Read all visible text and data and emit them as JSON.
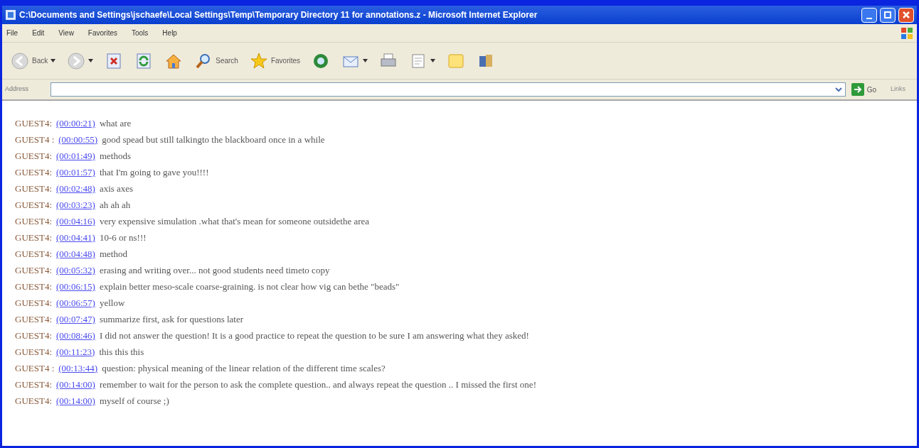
{
  "window": {
    "title": "C:\\Documents and Settings\\jschaefe\\Local Settings\\Temp\\Temporary Directory 11 for annotations.z - Microsoft Internet Explorer"
  },
  "menu": [
    "File",
    "Edit",
    "View",
    "Favorites",
    "Tools",
    "Help"
  ],
  "toolbar": [
    {
      "kind": "back",
      "label": "Back"
    },
    {
      "kind": "forward"
    },
    {
      "kind": "stop"
    },
    {
      "kind": "refresh"
    },
    {
      "kind": "home"
    },
    {
      "kind": "search",
      "label": "Search"
    },
    {
      "kind": "favorites",
      "label": "Favorites"
    },
    {
      "kind": "media"
    },
    {
      "kind": "mail"
    },
    {
      "kind": "print"
    },
    {
      "kind": "edit"
    },
    {
      "kind": "notes"
    },
    {
      "kind": "messenger"
    }
  ],
  "address_bar": {
    "label": "Address",
    "go": "Go",
    "links": "Links"
  },
  "entries": [
    {
      "speaker": "GUEST4:",
      "time": "(00:00:21)",
      "message": "what are"
    },
    {
      "speaker": "GUEST4 :",
      "time": "(00:00:55)",
      "message": "good spead but still talkingto the blackboard once in a while"
    },
    {
      "speaker": "GUEST4:",
      "time": "(00:01:49)",
      "message": "methods"
    },
    {
      "speaker": "GUEST4:",
      "time": "(00:01:57)",
      "message": "that I'm going to gave you!!!!"
    },
    {
      "speaker": "GUEST4:",
      "time": "(00:02:48)",
      "message": "axis axes"
    },
    {
      "speaker": "GUEST4:",
      "time": "(00:03:23)",
      "message": "ah ah ah"
    },
    {
      "speaker": "GUEST4:",
      "time": "(00:04:16)",
      "message": "very expensive simulation .what that's mean for someone outsidethe area"
    },
    {
      "speaker": "GUEST4:",
      "time": "(00:04:41)",
      "message": "10-6 or ns!!!"
    },
    {
      "speaker": "GUEST4:",
      "time": "(00:04:48)",
      "message": "method"
    },
    {
      "speaker": "GUEST4:",
      "time": "(00:05:32)",
      "message": "erasing and writing over... not good students need timeto copy"
    },
    {
      "speaker": "GUEST4:",
      "time": "(00:06:15)",
      "message": "explain better meso-scale coarse-graining. is not clear how vig can bethe \"beads\""
    },
    {
      "speaker": "GUEST4:",
      "time": "(00:06:57)",
      "message": "yellow"
    },
    {
      "speaker": "GUEST4:",
      "time": "(00:07:47)",
      "message": "summarize first, ask for questions later"
    },
    {
      "speaker": "GUEST4:",
      "time": "(00:08:46)",
      "message": "I did not answer the question! It is a good practice to repeat the question to be sure I am answering what they asked!"
    },
    {
      "speaker": "GUEST4:",
      "time": "(00:11:23)",
      "message": "this this this"
    },
    {
      "speaker": "GUEST4 :",
      "time": "(00:13:44)",
      "message": "question: physical meaning of the linear relation of the different time scales?"
    },
    {
      "speaker": "GUEST4:",
      "time": "(00:14:00)",
      "message": "remember to wait for the person to ask the complete question.. and always repeat the question .. I missed the first one!"
    },
    {
      "speaker": "GUEST4:",
      "time": "(00:14:00)",
      "message": "myself of course ;)"
    }
  ]
}
